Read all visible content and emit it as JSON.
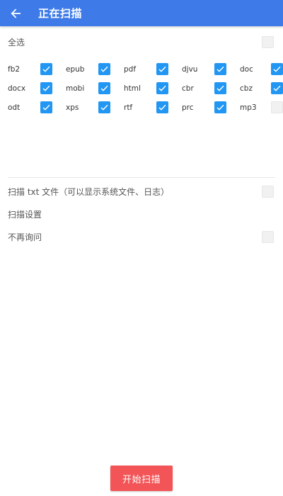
{
  "colors": {
    "primary": "#3f7be8",
    "checkbox_checked": "#2196f3",
    "start_button": "#f25457"
  },
  "header": {
    "title": "正在扫描",
    "back_icon": "arrow-left-icon"
  },
  "select_all": {
    "label": "全选",
    "checked": false
  },
  "formats": [
    [
      {
        "label": "fb2",
        "checked": true
      },
      {
        "label": "epub",
        "checked": true
      },
      {
        "label": "pdf",
        "checked": true
      },
      {
        "label": "djvu",
        "checked": true
      },
      {
        "label": "doc",
        "checked": true
      }
    ],
    [
      {
        "label": "docx",
        "checked": true
      },
      {
        "label": "mobi",
        "checked": true
      },
      {
        "label": "html",
        "checked": true
      },
      {
        "label": "cbr",
        "checked": true
      },
      {
        "label": "cbz",
        "checked": true
      }
    ],
    [
      {
        "label": "odt",
        "checked": true
      },
      {
        "label": "xps",
        "checked": true
      },
      {
        "label": "rtf",
        "checked": true
      },
      {
        "label": "prc",
        "checked": true
      },
      {
        "label": "mp3",
        "checked": false
      }
    ]
  ],
  "scan_txt": {
    "label": "扫描 txt 文件（可以显示系统文件、日志）",
    "checked": false
  },
  "scan_settings": {
    "label": "扫描设置"
  },
  "dont_ask": {
    "label": "不再询问",
    "checked": false
  },
  "start_button": {
    "label": "开始扫描"
  }
}
